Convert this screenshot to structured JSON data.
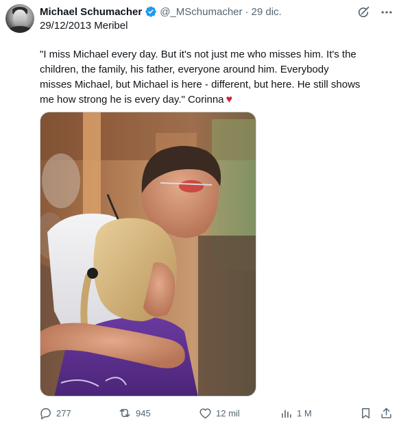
{
  "tweet": {
    "display_name": "Michael Schumacher",
    "handle": "@_MSchumacher",
    "separator": "·",
    "date": "29 dic.",
    "subline": "29/12/2013 Meribel",
    "text": "\"I miss Michael every day. But it's not just me who misses him. It's the children, the family, his father, everyone around him. Everybody misses Michael, but Michael is here - different, but here. He still shows me how strong he is every day.\" Corinna",
    "emoji": "♥",
    "accent_color": "#1d9bf0",
    "heart_color": "#d1213a"
  },
  "actions": {
    "replies": "277",
    "reposts": "945",
    "likes": "12 mil",
    "views": "1 M"
  },
  "icons": {
    "verified": "verified-badge-icon",
    "grok": "grok-icon",
    "more": "more-icon",
    "reply": "reply-icon",
    "repost": "repost-icon",
    "like": "like-icon",
    "views": "views-icon",
    "bookmark": "bookmark-icon",
    "share": "share-icon"
  }
}
